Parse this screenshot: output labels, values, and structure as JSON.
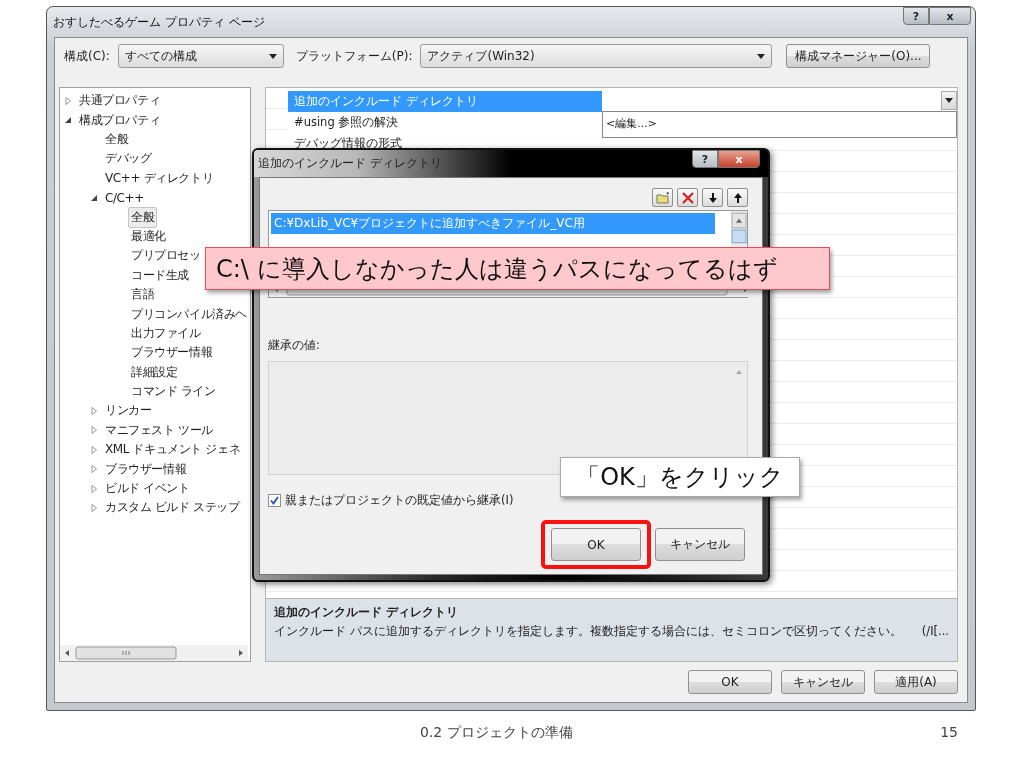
{
  "window": {
    "title": "おすしたべるゲーム プロパティ ページ",
    "caption_buttons": [
      "?",
      "x"
    ]
  },
  "toolbar": {
    "configuration_label": "構成(C):",
    "configuration": "すべての構成",
    "platform_label": "プラットフォーム(P):",
    "platform": "アクティブ(Win32)",
    "manager_button": "構成マネージャー(O)..."
  },
  "tree": [
    {
      "label": "共通プロパティ",
      "expanded": false,
      "selected": false
    },
    {
      "label": "構成プロパティ",
      "expanded": true,
      "selected": false,
      "children": [
        {
          "label": "全般",
          "selected": false
        },
        {
          "label": "デバッグ",
          "selected": false
        },
        {
          "label": "VC++ ディレクトリ",
          "selected": false
        },
        {
          "label": "C/C++",
          "expanded": true,
          "selected": false,
          "children": [
            {
              "label": "全般",
              "selected": true
            },
            {
              "label": "最適化",
              "selected": false
            },
            {
              "label": "プリプロセッ",
              "selected": false
            },
            {
              "label": "コード生成",
              "selected": false
            },
            {
              "label": "言語",
              "selected": false
            },
            {
              "label": "プリコンパイル済みヘ",
              "selected": false
            },
            {
              "label": "出力ファイル",
              "selected": false
            },
            {
              "label": "ブラウザー情報",
              "selected": false
            },
            {
              "label": "詳細設定",
              "selected": false
            },
            {
              "label": "コマンド ライン",
              "selected": false
            }
          ]
        },
        {
          "label": "リンカー",
          "expanded": false,
          "selected": false
        },
        {
          "label": "マニフェスト ツール",
          "expanded": false,
          "selected": false
        },
        {
          "label": "XML ドキュメント ジェネ",
          "expanded": false,
          "selected": false
        },
        {
          "label": "ブラウザー情報",
          "expanded": false,
          "selected": false
        },
        {
          "label": "ビルド イベント",
          "expanded": false,
          "selected": false
        },
        {
          "label": "カスタム ビルド ステップ",
          "expanded": false,
          "selected": false
        }
      ]
    }
  ],
  "properties": {
    "rows": [
      {
        "name": "追加のインクルード ディレクトリ",
        "selected": true
      },
      {
        "name": "#using 参照の解決",
        "selected": false
      },
      {
        "name": "デバッグ情報の形式",
        "selected": false
      }
    ],
    "dropdown_item": "<編集...>"
  },
  "description": {
    "title": "追加のインクルード ディレクトリ",
    "text": "インクルード パスに追加するディレクトリを指定します。複数指定する場合には、セミコロンで区切ってください。",
    "switch": "(/I[..."
  },
  "buttons": [
    "OK",
    "キャンセル",
    "適用(A)"
  ],
  "dialog": {
    "title": "追加のインクルード ディレクトリ",
    "caption_buttons": [
      "?",
      "x"
    ],
    "directories": [
      {
        "path": "C:¥DxLib_VC¥プロジェクトに追加すべきファイル_VC用",
        "selected": true
      }
    ],
    "inherited_label": "継承の値:",
    "inherit": {
      "label": "親またはプロジェクトの既定値から継承(I)",
      "checked": true
    },
    "buttons": [
      {
        "label": "OK",
        "highlighted": true
      },
      {
        "label": "キャンセル",
        "highlighted": false
      }
    ]
  },
  "callouts": [
    {
      "kind": "warning",
      "text": "C:\\ に導入しなかった人は違うパスになってるはず"
    },
    {
      "kind": "note",
      "text": "「OK」をクリック"
    }
  ],
  "footer": {
    "section": "0.2 プロジェクトの準備",
    "page": "15"
  }
}
